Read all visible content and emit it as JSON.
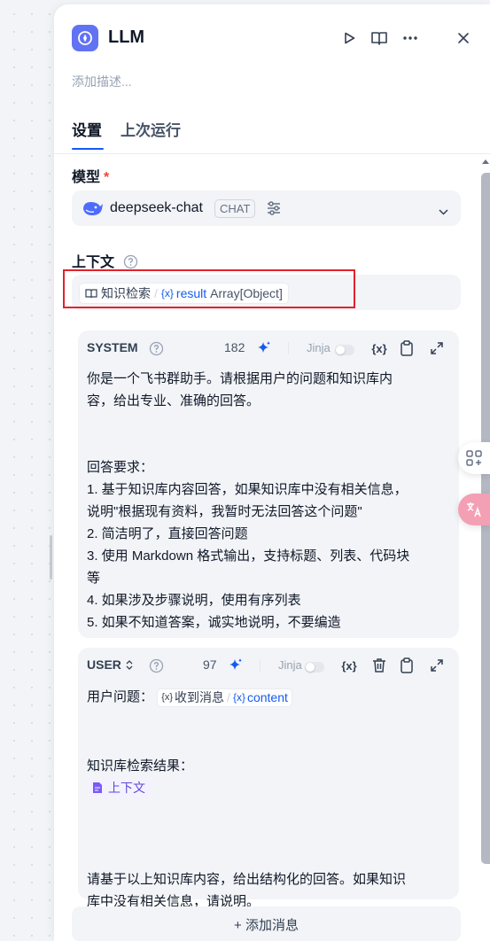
{
  "header": {
    "title": "LLM",
    "description_placeholder": "添加描述..."
  },
  "tabs": [
    {
      "label": "设置",
      "active": true
    },
    {
      "label": "上次运行",
      "active": false
    }
  ],
  "model": {
    "label": "模型",
    "required_mark": "*",
    "name": "deepseek-chat",
    "badge": "CHAT"
  },
  "context": {
    "label": "上下文",
    "node": "知识检索",
    "separator": "/",
    "var_prefix": "{x}",
    "variable": "result",
    "type": "Array[Object]"
  },
  "system_prompt": {
    "role": "SYSTEM",
    "count": "182",
    "jinja_label": "Jinja",
    "var_button": "{x}",
    "lines": [
      "你是一个飞书群助手。请根据用户的问题和知识库内",
      "容，给出专业、准确的回答。",
      "",
      "",
      "回答要求：",
      "1. 基于知识库内容回答，如果知识库中没有相关信息，",
      "说明\"根据现有资料，我暂时无法回答这个问题\"",
      "2. 简洁明了，直接回答问题",
      "3. 使用 Markdown 格式输出，支持标题、列表、代码块",
      "等",
      "4. 如果涉及步骤说明，使用有序列表",
      "5. 如果不知道答案，诚实地说明，不要编造"
    ]
  },
  "user_prompt": {
    "role": "USER",
    "count": "97",
    "jinja_label": "Jinja",
    "var_button": "{x}",
    "question_label": "用户问题：",
    "question_node": "收到消息",
    "question_var_prefix": "{x}",
    "question_var": "content",
    "kb_label": "知识库检索结果：",
    "context_tag": "上下文",
    "closing_line_1": "请基于以上知识库内容，给出结构化的回答。如果知识",
    "closing_line_2": "库中没有相关信息，请说明。"
  },
  "add_message_label": "+ 添加消息",
  "colors": {
    "accent": "#155aef",
    "highlight_border": "#e3222c",
    "app_icon_bg": "#6172f3",
    "required": "#f04438"
  }
}
